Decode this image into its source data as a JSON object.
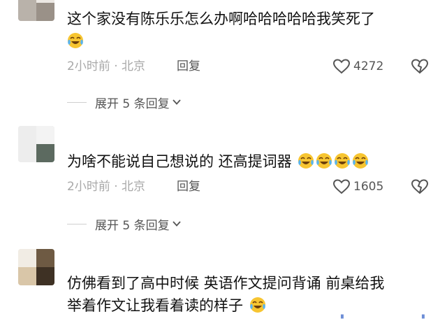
{
  "comments": [
    {
      "username": "",
      "text": "这个家没有陈乐乐怎么办啊哈哈哈哈哈我笑死了",
      "time": "2小时前",
      "location": "北京",
      "reply_label": "回复",
      "likes": "4272",
      "expand_label": "展开 5 条回复"
    },
    {
      "username": "",
      "text": "为啥不能说自己想说的 还高提词器",
      "time": "2小时前",
      "location": "北京",
      "reply_label": "回复",
      "likes": "1605",
      "expand_label": "展开 5 条回复"
    },
    {
      "username": "",
      "text_line1": "仿佛看到了高中时候 英语作文提问背诵 前桌给我",
      "text_line2": "举着作文让我看着读的样子"
    }
  ],
  "icons": {
    "emoji": "laughing-crying-emoji",
    "like": "heart-outline-icon",
    "dislike": "heart-broken-icon",
    "expand": "chevron-down-icon"
  },
  "colors": {
    "text": "#111111",
    "meta": "#a8a8a8",
    "action": "#555555",
    "emoji_face": "#f7c531"
  }
}
